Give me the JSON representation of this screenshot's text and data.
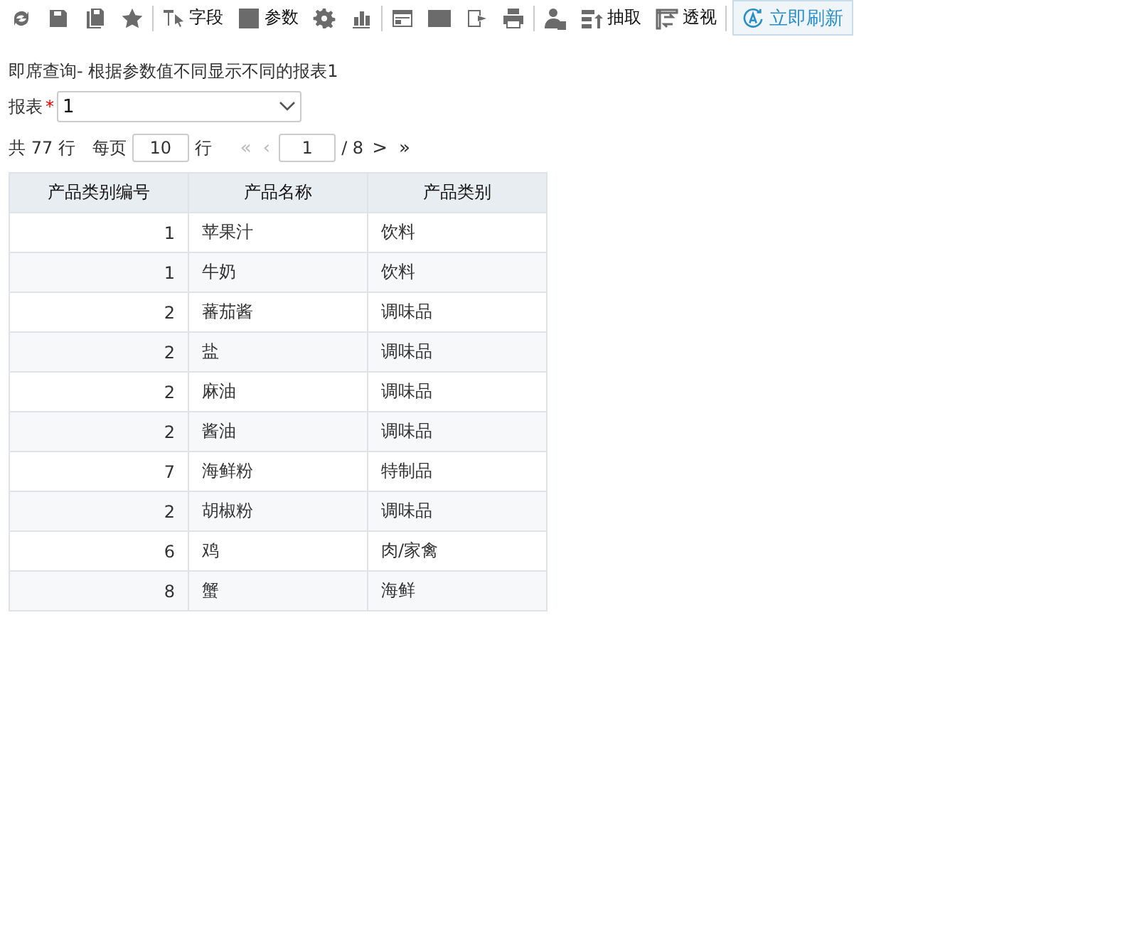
{
  "toolbar": {
    "field_label": "字段",
    "param_label": "参数",
    "extract_label": "抽取",
    "pivot_label": "透视",
    "refresh_label": "立即刷新"
  },
  "report_title": "即席查询- 根据参数值不同显示不同的报表1",
  "parameter": {
    "label": "报表",
    "required": true,
    "required_mark": "*",
    "value": "1"
  },
  "pager": {
    "total": "共 77 行",
    "per_page_label": "每页",
    "per_page": "10",
    "rows_label": "行",
    "page": "1",
    "page_count": "/ 8",
    "first": "«",
    "first_disabled": true,
    "prev": "‹",
    "prev_disabled": true,
    "next": ">",
    "last": "»"
  },
  "table": {
    "columns": [
      "产品类别编号",
      "产品名称",
      "产品类别"
    ],
    "rows": [
      [
        "1",
        "苹果汁",
        "饮料"
      ],
      [
        "1",
        "牛奶",
        "饮料"
      ],
      [
        "2",
        "蕃茄酱",
        "调味品"
      ],
      [
        "2",
        "盐",
        "调味品"
      ],
      [
        "2",
        "麻油",
        "调味品"
      ],
      [
        "2",
        "酱油",
        "调味品"
      ],
      [
        "7",
        "海鲜粉",
        "特制品"
      ],
      [
        "2",
        "胡椒粉",
        "调味品"
      ],
      [
        "6",
        "鸡",
        "肉/家禽"
      ],
      [
        "8",
        "蟹",
        "海鲜"
      ]
    ]
  }
}
